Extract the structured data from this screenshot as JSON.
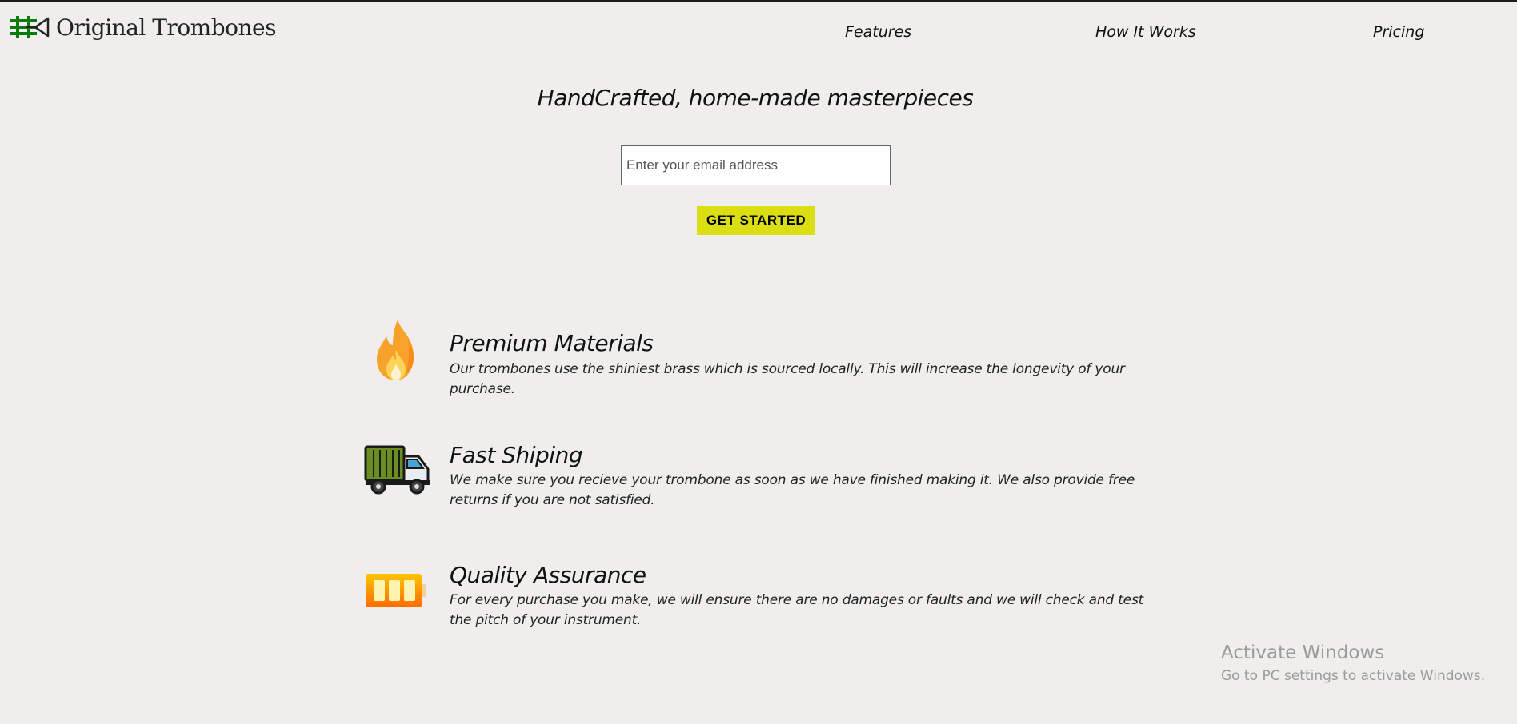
{
  "header": {
    "brand": "Original Trombones",
    "logo_icon": "trombone-logo-icon",
    "nav": [
      {
        "label": "Features"
      },
      {
        "label": "How It Works"
      },
      {
        "label": "Pricing"
      }
    ]
  },
  "hero": {
    "title": "HandCrafted, home-made masterpieces",
    "email_placeholder": "Enter your email address",
    "cta_label": "GET STARTED",
    "cta_color": "#dcde14"
  },
  "features": [
    {
      "icon": "fire-icon",
      "title": "Premium Materials",
      "description": "Our trombones use the shiniest brass which is sourced locally. This will increase the longevity of your purchase."
    },
    {
      "icon": "truck-icon",
      "title": "Fast Shiping",
      "description": "We make sure you recieve your trombone as soon as we have finished making it. We also provide free returns if you are not satisfied."
    },
    {
      "icon": "battery-icon",
      "title": "Quality Assurance",
      "description": "For every purchase you make, we will ensure there are no damages or faults and we will check and test the pitch of your instrument."
    }
  ],
  "watermark": {
    "title": "Activate Windows",
    "subtitle": "Go to PC settings to activate Windows."
  }
}
